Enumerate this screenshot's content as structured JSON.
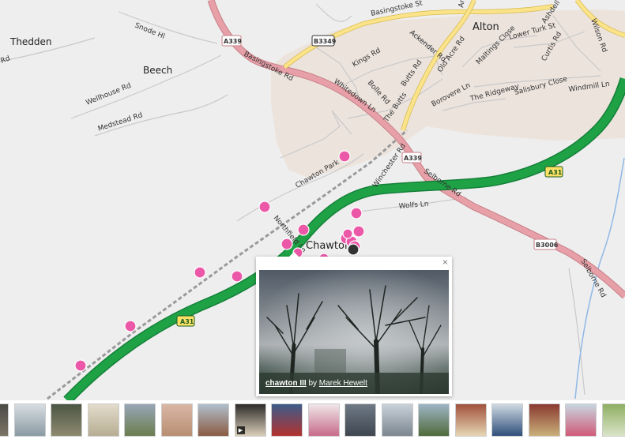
{
  "map": {
    "places": [
      {
        "name": "Thedden",
        "kind": "place"
      },
      {
        "name": "Beech",
        "kind": "place"
      },
      {
        "name": "Alton",
        "kind": "town"
      },
      {
        "name": "Chawton",
        "kind": "town"
      }
    ],
    "streets": [
      "Snode Hl",
      "Wellhouse Rd",
      "Medstead Rd",
      "Basingstoke Rd",
      "Whitedown Ln",
      "Chawton Park Rd",
      "Northfield Ln",
      "Winchester Rd",
      "Selborne Rd",
      "Wolfs Ln",
      "Basingstoke St",
      "Ackender Rd",
      "Kings Rd",
      "Bolle Rd",
      "The Butts",
      "Butts Rd",
      "Old Acre Rd",
      "Borovere Ln",
      "Maltings Close",
      "Lower Turk St",
      "Ashdell Rd",
      "Curtis Rd",
      "Wilson Rd",
      "The Ridgeway",
      "Salisbury Close",
      "Windmill Ln",
      "Amery St"
    ],
    "shields": [
      "A339",
      "B3349",
      "A339",
      "A31",
      "A31",
      "B3006"
    ],
    "rd_fragment": "Rd",
    "colors": {
      "background": "#eeeeee",
      "urban": "#ece3dc",
      "minor_road": "#ffffff",
      "minor_road_casing": "#c9c9c9",
      "a_road": "#e8a0a8",
      "b_road": "#fbe38a",
      "motorway": "#1ea245",
      "railway": "#999999",
      "water": "#8fb8e6",
      "marker": "#ec58a8"
    },
    "marker_count": 18
  },
  "popup": {
    "title": "chawton III",
    "by": "by",
    "author": "Marek Hewelt",
    "close": "×"
  },
  "thumbnails": [
    {
      "label": "thumb-1",
      "c1": "#4a4a45",
      "c2": "#7a7466"
    },
    {
      "label": "thumb-2",
      "c1": "#d8dde2",
      "c2": "#8b9aa4"
    },
    {
      "label": "thumb-3",
      "c1": "#4b5644",
      "c2": "#8f8a70"
    },
    {
      "label": "thumb-4",
      "c1": "#e3dccb",
      "c2": "#b7ad93"
    },
    {
      "label": "thumb-5",
      "c1": "#98a6b6",
      "c2": "#6b7e4e"
    },
    {
      "label": "thumb-6",
      "c1": "#d9b7a6",
      "c2": "#b88e72"
    },
    {
      "label": "thumb-7",
      "c1": "#b0bfcc",
      "c2": "#8b5b43"
    },
    {
      "label": "thumb-8",
      "c1": "#2d2b29",
      "c2": "#d8cdb8",
      "video": true
    },
    {
      "label": "thumb-9",
      "c1": "#3d5c8a",
      "c2": "#b3322e"
    },
    {
      "label": "thumb-10",
      "c1": "#f0e6e8",
      "c2": "#c86b8a"
    },
    {
      "label": "thumb-11",
      "c1": "#6f7a86",
      "c2": "#3e4650"
    },
    {
      "label": "thumb-12",
      "c1": "#c9d1d9",
      "c2": "#7c8690"
    },
    {
      "label": "thumb-13",
      "c1": "#9eb5c6",
      "c2": "#4f6a3a"
    },
    {
      "label": "thumb-14",
      "c1": "#a0513c",
      "c2": "#e6d6b4"
    },
    {
      "label": "thumb-15",
      "c1": "#cfd9e3",
      "c2": "#2f4f7a"
    },
    {
      "label": "thumb-16",
      "c1": "#8a3a30",
      "c2": "#c9b07a"
    },
    {
      "label": "thumb-17",
      "c1": "#c8d6e0",
      "c2": "#d05a78"
    },
    {
      "label": "thumb-18",
      "c1": "#8fae62",
      "c2": "#d9e4c8"
    }
  ]
}
